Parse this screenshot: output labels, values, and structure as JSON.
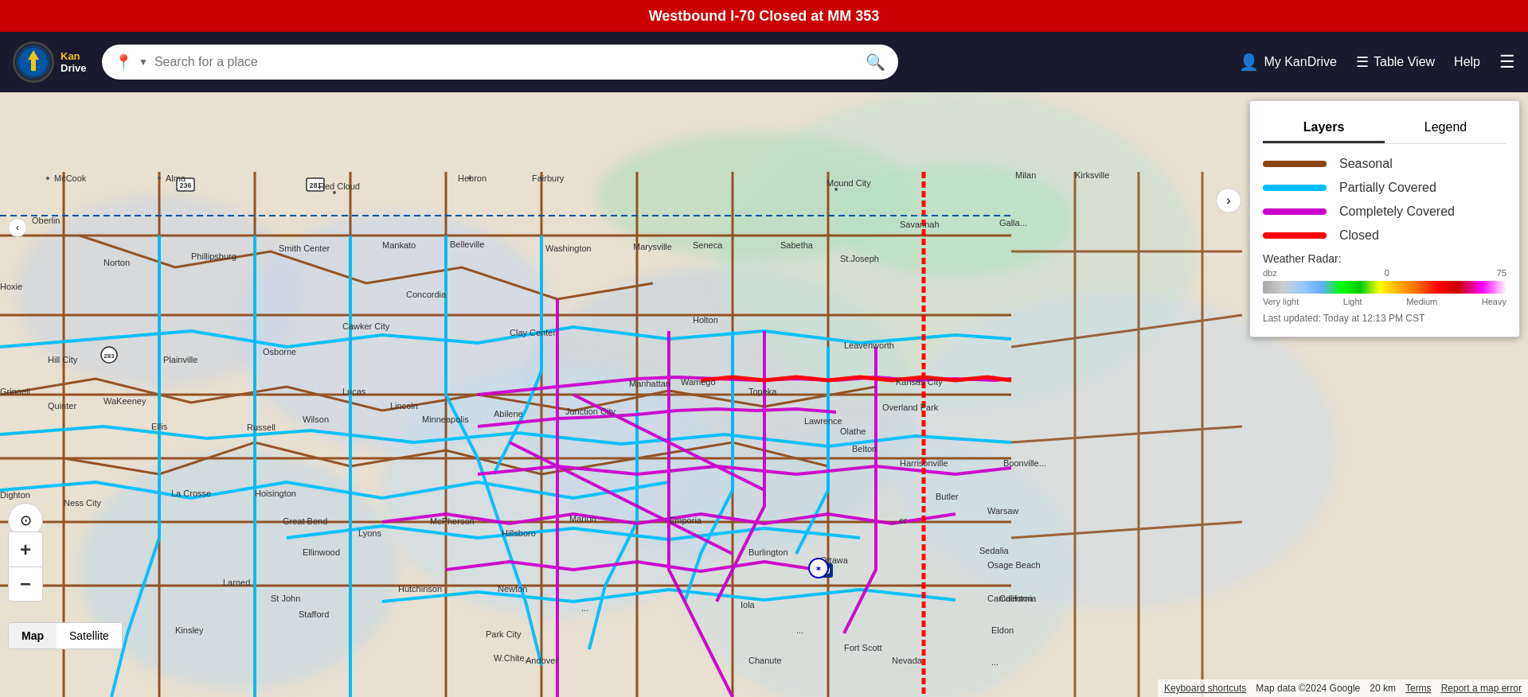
{
  "alert": {
    "text": "Westbound I-70 Closed at MM 353"
  },
  "header": {
    "logo_alt": "KanDrive",
    "search_placeholder": "Search for a place",
    "nav": {
      "my_kandrive": "My KanDrive",
      "table_view": "Table View",
      "help": "Help"
    }
  },
  "map": {
    "expand_arrow": "›",
    "collapse_arrow": "‹",
    "location_icon": "⊙",
    "zoom_in": "+",
    "zoom_out": "−",
    "map_label": "Map",
    "satellite_label": "Satellite",
    "panel_arrow": "›"
  },
  "legend_panel": {
    "tabs": [
      {
        "label": "Layers",
        "active": true
      },
      {
        "label": "Legend",
        "active": false
      }
    ],
    "items": [
      {
        "label": "Seasonal",
        "color": "#8B4513"
      },
      {
        "label": "Partially Covered",
        "color": "#00BFFF"
      },
      {
        "label": "Completely Covered",
        "color": "#CC00CC"
      },
      {
        "label": "Closed",
        "color": "#FF0000"
      }
    ],
    "weather_radar": {
      "label": "Weather Radar:",
      "scale_left": "dbz",
      "scale_mid": "0",
      "scale_right": "75",
      "label_very_light": "Very light",
      "label_light": "Light",
      "label_medium": "Medium",
      "label_heavy": "Heavy"
    },
    "last_updated": "Last updated: Today at 12:13 PM CST"
  },
  "bottom_bar": {
    "keyboard_shortcuts": "Keyboard shortcuts",
    "map_data": "Map data ©2024 Google",
    "scale": "20 km",
    "terms": "Terms",
    "report_error": "Report a map error"
  }
}
